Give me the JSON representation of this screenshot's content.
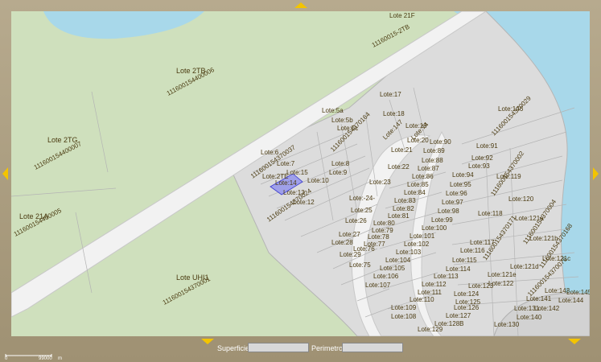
{
  "map": {
    "lot_labels": [
      {
        "text": "Lote 21F"
      },
      {
        "text": "11160015-2TB"
      },
      {
        "text": "111600154400006"
      },
      {
        "text": "Lote 2TB"
      },
      {
        "text": "Lote 2TG"
      },
      {
        "text": "111600154400007"
      },
      {
        "text": "111600154400005"
      },
      {
        "text": "Lote 21A"
      },
      {
        "text": "Lote UHI1"
      },
      {
        "text": "111600154370001"
      },
      {
        "text": "Lote:17"
      },
      {
        "text": "Lote:5a"
      },
      {
        "text": "Lote:5b"
      },
      {
        "text": "Lote:5c"
      },
      {
        "text": "Lote:18"
      },
      {
        "text": "Lote:19"
      },
      {
        "text": "Lote:20"
      },
      {
        "text": "Lote:21"
      },
      {
        "text": "Lote:22"
      },
      {
        "text": "Lote:23"
      },
      {
        "text": "Lote:14"
      },
      {
        "text": "Lote:13"
      },
      {
        "text": "Lote:12"
      },
      {
        "text": "Lote:10"
      },
      {
        "text": "Lote:9"
      },
      {
        "text": "Lote:8"
      },
      {
        "text": "Lote:7"
      },
      {
        "text": "Lote:6"
      },
      {
        "text": "Lote:2TE"
      },
      {
        "text": "Lote:15"
      },
      {
        "text": "Lote:-24-"
      },
      {
        "text": "Lote:25"
      },
      {
        "text": "Lote:26"
      },
      {
        "text": "Lote:27"
      },
      {
        "text": "Lote:28"
      },
      {
        "text": "Lote:29"
      },
      {
        "text": "Lote:75"
      },
      {
        "text": "Lote:76"
      },
      {
        "text": "Lote:77"
      },
      {
        "text": "Lote:78"
      },
      {
        "text": "Lote:79"
      },
      {
        "text": "Lote:80"
      },
      {
        "text": "Lote:81"
      },
      {
        "text": "Lote:82"
      },
      {
        "text": "Lote:83"
      },
      {
        "text": "Lote:84"
      },
      {
        "text": "Lote:85"
      },
      {
        "text": "Lote:86"
      },
      {
        "text": "Lote:87"
      },
      {
        "text": "Lote:88"
      },
      {
        "text": "Lote:89"
      },
      {
        "text": "Lote:90"
      },
      {
        "text": "Lote:91"
      },
      {
        "text": "Lote:92"
      },
      {
        "text": "Lote:93"
      },
      {
        "text": "Lote:94"
      },
      {
        "text": "Lote:95"
      },
      {
        "text": "Lote:96"
      },
      {
        "text": "Lote:97"
      },
      {
        "text": "Lote:98"
      },
      {
        "text": "Lote:99"
      },
      {
        "text": "Lote:100"
      },
      {
        "text": "Lote:101"
      },
      {
        "text": "Lote:102"
      },
      {
        "text": "Lote:103"
      },
      {
        "text": "Lote:104"
      },
      {
        "text": "Lote:105"
      },
      {
        "text": "Lote:106"
      },
      {
        "text": "Lote:107"
      },
      {
        "text": "Lote:108"
      },
      {
        "text": "Lote:109"
      },
      {
        "text": "Lote:110"
      },
      {
        "text": "Lote:111"
      },
      {
        "text": "Lote:112"
      },
      {
        "text": "Lote:113"
      },
      {
        "text": "Lote:114"
      },
      {
        "text": "Lote:115"
      },
      {
        "text": "Lote:116"
      },
      {
        "text": "Lote:117"
      },
      {
        "text": "Lote:118"
      },
      {
        "text": "Lote:119"
      },
      {
        "text": "Lote:120"
      },
      {
        "text": "Lote:121a"
      },
      {
        "text": "Lote:121b"
      },
      {
        "text": "Lote:121c"
      },
      {
        "text": "Lote:121d"
      },
      {
        "text": "Lote:121e"
      },
      {
        "text": "Lote:122"
      },
      {
        "text": "Lote:123"
      },
      {
        "text": "Lote:124"
      },
      {
        "text": "Lote:125"
      },
      {
        "text": "Lote:126"
      },
      {
        "text": "Lote:127"
      },
      {
        "text": "Lote:128B"
      },
      {
        "text": "Lote:129"
      },
      {
        "text": "Lote:130"
      },
      {
        "text": "Lote:131"
      },
      {
        "text": "Lote:140"
      },
      {
        "text": "Lote:141"
      },
      {
        "text": "Lote:142"
      },
      {
        "text": "Lote:143"
      },
      {
        "text": "Lote:144"
      },
      {
        "text": "Lote:145"
      },
      {
        "text": "Lote:146"
      },
      {
        "text": "Lote:147"
      },
      {
        "text": "Lote:74"
      },
      {
        "text": "111600154370029"
      },
      {
        "text": "111600154370037"
      },
      {
        "text": "111600154370024"
      },
      {
        "text": "111600154370002"
      },
      {
        "text": "111600154370004"
      },
      {
        "text": "111600154370171"
      },
      {
        "text": "111600154370168"
      },
      {
        "text": "111600154370076"
      },
      {
        "text": "111600154370164"
      },
      {
        "text": "111600154370143"
      },
      {
        "text": "111600154370155"
      }
    ]
  },
  "footer": {
    "superficie_label": "Superficie",
    "perimetro_label": "Perimetro",
    "scale_zero": "0",
    "scale_value": "99000",
    "scale_unit": "m"
  },
  "colors": {
    "green_area": "#cfe0bd",
    "lots_area": "#dcdcdc",
    "road": "#f2f2f2",
    "water": "#a8d8ea",
    "selected_lot": "#9fa0ea",
    "label_text": "#4a3a10"
  }
}
